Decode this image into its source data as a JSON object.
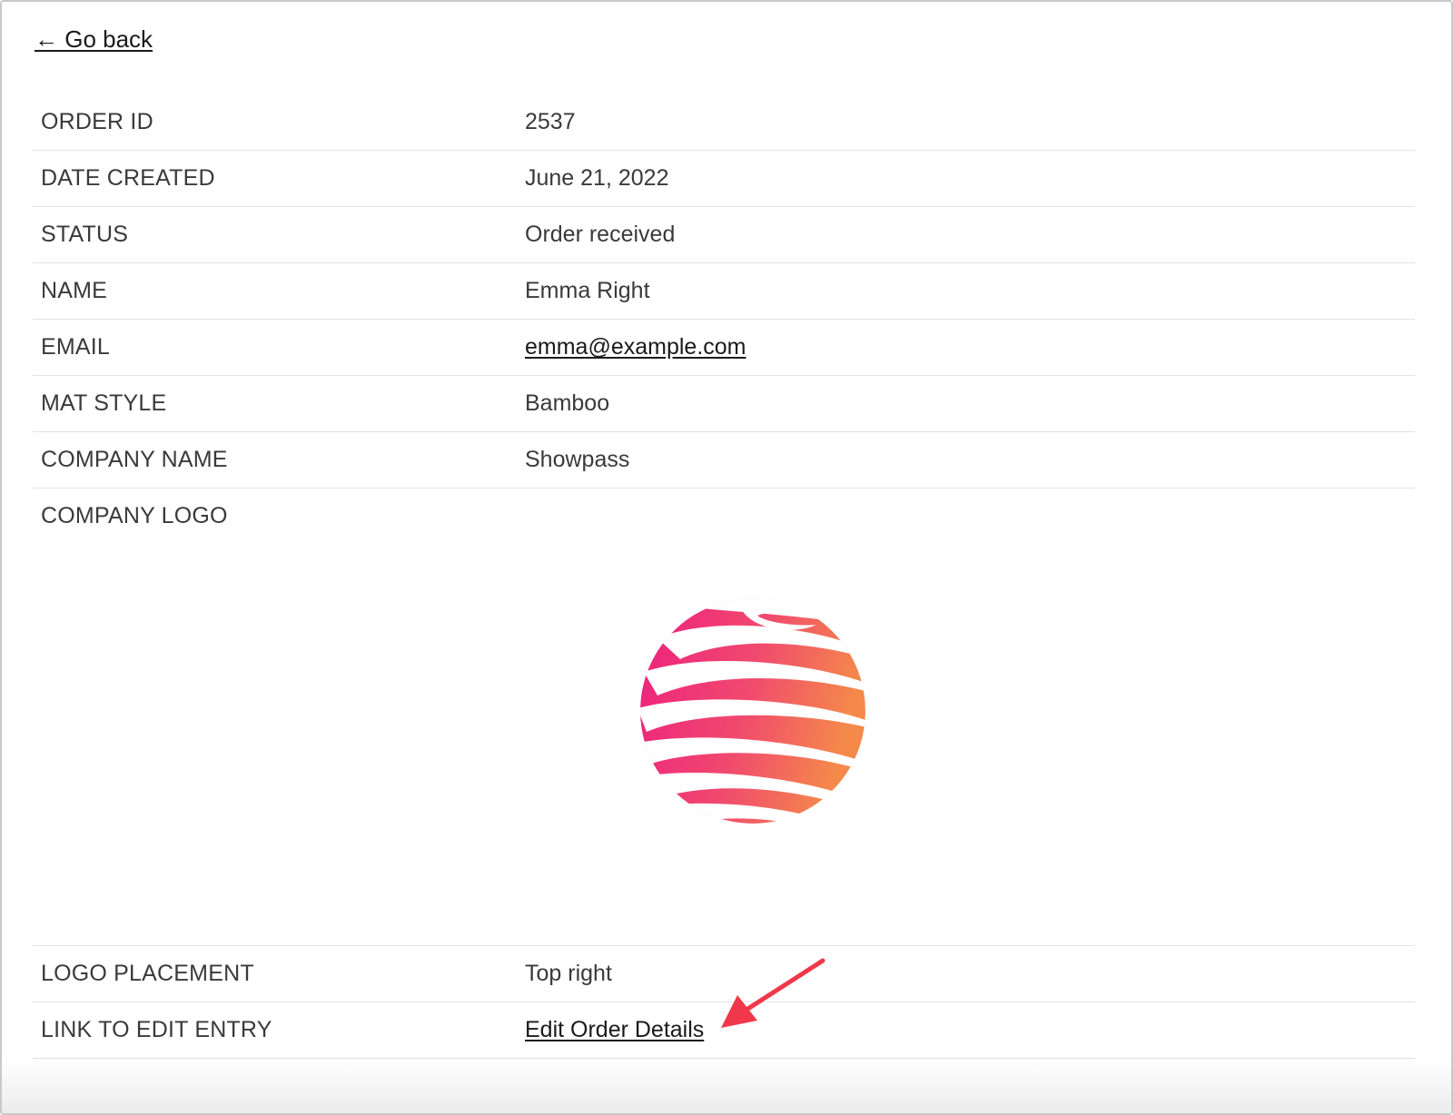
{
  "nav": {
    "back_label": "← Go back"
  },
  "order": {
    "rows": [
      {
        "label": "ORDER ID",
        "value": "2537"
      },
      {
        "label": "DATE CREATED",
        "value": "June 21, 2022"
      },
      {
        "label": "STATUS",
        "value": "Order received"
      },
      {
        "label": "NAME",
        "value": "Emma Right"
      },
      {
        "label": "EMAIL",
        "value": "emma@example.com"
      },
      {
        "label": "MAT STYLE",
        "value": "Bamboo"
      },
      {
        "label": "COMPANY NAME",
        "value": "Showpass"
      },
      {
        "label": "COMPANY LOGO",
        "value": ""
      },
      {
        "label": "LOGO PLACEMENT",
        "value": "Top right"
      },
      {
        "label": "LINK TO EDIT ENTRY",
        "value": "Edit Order Details"
      }
    ]
  },
  "logo": {
    "icon": "striped-sphere-logo",
    "gradient_start": "#ee1f80",
    "gradient_end": "#f5894a"
  },
  "annotation": {
    "icon": "red-arrow-icon",
    "color": "#f0384a"
  }
}
